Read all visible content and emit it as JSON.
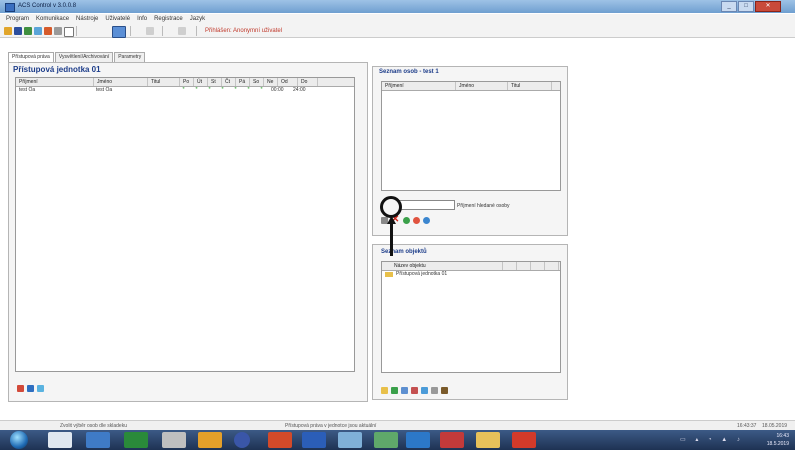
{
  "window": {
    "title": "ACS Control v 3.0.0.8",
    "minimize": "_",
    "maximize": "□",
    "close": "✕"
  },
  "menu": {
    "items": [
      "Program",
      "Komunikace",
      "Nástroje",
      "Uživatelé",
      "Info",
      "Registrace",
      "Jazyk"
    ]
  },
  "toolbar": {
    "status": "Přihlášen: Anonymní uživatel"
  },
  "tabs": [
    "Přístupová práva",
    "Vysvětlení/Archivování",
    "Parametry"
  ],
  "left_group": {
    "title": "Přístupová jednotka 01",
    "columns": [
      "Příjmení",
      "Jméno",
      "Titul",
      "Po",
      "Út",
      "St",
      "Čt",
      "Pá",
      "So",
      "Ne",
      "Od",
      "Do"
    ],
    "rows": [
      {
        "prijmeni": "test Oa",
        "jmeno": "test Oa",
        "titul": "",
        "days": [
          "*",
          "*",
          "*",
          "*",
          "*",
          "*",
          "*"
        ],
        "od": "00:00",
        "do": "24:00"
      }
    ]
  },
  "persons_group": {
    "title": "Seznam osob - test 1",
    "columns": [
      "Příjmení",
      "Jméno",
      "Titul"
    ],
    "search_label": "Příjmení hledané osoby",
    "search_value": ""
  },
  "objects_group": {
    "title": "Seznam objektů",
    "columns": [
      "Název objektu"
    ],
    "items": [
      "Přístupová jednotka 01"
    ]
  },
  "statusbar": {
    "left": "Zvolit výběr osob dle skladeku",
    "center": "Přístupová práva v jednotce jsou aktuální",
    "time": "16:43:37",
    "date": "18.05.2019"
  },
  "taskbar": {
    "clock_time": "16:43",
    "clock_date": "18.5.2019"
  },
  "colors": {
    "title_accent": "#1d3d8a",
    "status_red": "#c0392b",
    "star_green": "#2e9d2e"
  }
}
